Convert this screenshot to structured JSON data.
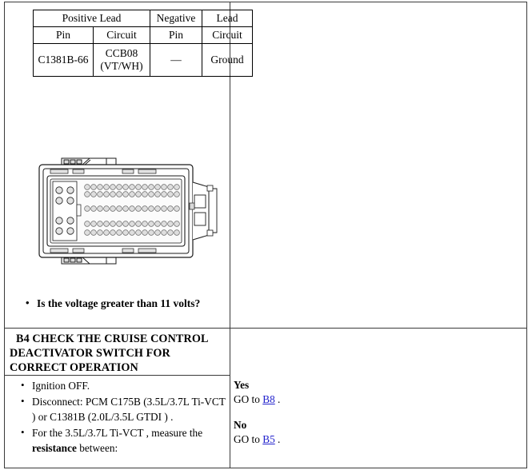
{
  "document": {
    "title": "Pinpoint Test Step B4"
  },
  "lead_table": {
    "group_headers": [
      {
        "label": "Positive Lead",
        "span": 2
      },
      {
        "label": "Negative",
        "span": 1
      },
      {
        "label": "Lead",
        "span": 1
      }
    ],
    "column_headers": [
      "Pin",
      "Circuit",
      "Pin",
      "Circuit"
    ],
    "rows": [
      {
        "positive_pin": "C1381B-66",
        "positive_circuit": "CCB08 (VT/WH)",
        "negative_pin": "—",
        "negative_circuit": "Ground"
      }
    ]
  },
  "connector_figure": {
    "name": "connector-pin-layout-diagram",
    "alt": "Electrical connector face view showing pin cavity layout",
    "small_pin_rows": 5,
    "small_pins_per_row": 19,
    "large_pin_rows": 4,
    "large_pins_per_row": 2
  },
  "voltage_check": {
    "bullets": [
      "Is the voltage greater than 11 volts?"
    ]
  },
  "step_b4": {
    "header_lines": [
      "B4 CHECK THE CRUISE CONTROL",
      "DEACTIVATOR SWITCH FOR",
      "CORRECT OPERATION"
    ],
    "bullets": [
      "Ignition OFF.",
      "Disconnect: PCM C175B (3.5L/3.7L Ti-VCT ) or C1381B (2.0L/3.5L GTDI ) .",
      "For the 3.5L/3.7L Ti-VCT , measure the "
    ],
    "bullet3_bold": "resistance",
    "bullet3_tail": " between:"
  },
  "results": {
    "yes": {
      "label": "Yes",
      "prefix": "GO to ",
      "link": "B8",
      "suffix": " ."
    },
    "no": {
      "label": "No",
      "prefix": "GO to ",
      "link": "B5",
      "suffix": " ."
    }
  },
  "colors": {
    "link": "#2222cc",
    "border": "#3a3a3a",
    "text": "#000000",
    "figure_line": "#1a1a1a",
    "figure_fill": "#e8e8e8"
  }
}
